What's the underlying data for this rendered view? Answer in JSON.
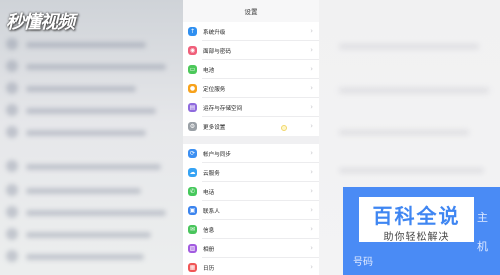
{
  "watermark": "秒懂视频",
  "screen": {
    "title": "设置",
    "groups": [
      [
        {
          "label": "系统升级",
          "icon": "system-update-icon",
          "color": "#2f8ff0",
          "glyph": "↑"
        },
        {
          "label": "面部与密码",
          "icon": "face-lock-icon",
          "color": "#f05f7a",
          "glyph": "◉"
        },
        {
          "label": "电池",
          "icon": "battery-icon",
          "color": "#4cc85a",
          "glyph": "▭"
        },
        {
          "label": "定位服务",
          "icon": "location-icon",
          "color": "#f7a21b",
          "glyph": "●"
        },
        {
          "label": "运存与存储空间",
          "icon": "storage-icon",
          "color": "#8f6bde",
          "glyph": "▤"
        },
        {
          "label": "更多设置",
          "icon": "more-settings-icon",
          "color": "#9aa0a6",
          "glyph": "⚙"
        }
      ],
      [
        {
          "label": "帐户与同步",
          "icon": "account-sync-icon",
          "color": "#3c8ff2",
          "glyph": "⟳"
        },
        {
          "label": "云服务",
          "icon": "cloud-icon",
          "color": "#36a3f4",
          "glyph": "☁"
        },
        {
          "label": "电话",
          "icon": "phone-icon",
          "color": "#45c85b",
          "glyph": "✆"
        },
        {
          "label": "联系人",
          "icon": "contacts-icon",
          "color": "#3b84ee",
          "glyph": "▣"
        },
        {
          "label": "信息",
          "icon": "messages-icon",
          "color": "#49c55c",
          "glyph": "✉"
        },
        {
          "label": "相册",
          "icon": "album-icon",
          "color": "#a25be0",
          "glyph": "▨"
        },
        {
          "label": "日历",
          "icon": "calendar-icon",
          "color": "#f05656",
          "glyph": "▦"
        }
      ]
    ]
  },
  "ad": {
    "title": "百科全说",
    "subtitle": "助你轻松解决",
    "side1": "主",
    "side2": "机",
    "bottom": "号码",
    "color": "#4a8bf5"
  }
}
